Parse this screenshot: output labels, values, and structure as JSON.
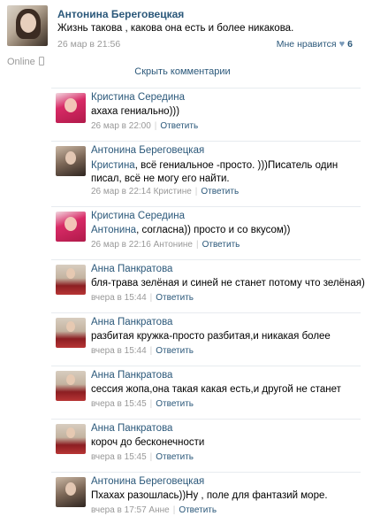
{
  "post": {
    "author": "Антонина Береговецкая",
    "text": "Жизнь такова , какова она есть и более никакова.",
    "date": "26 мар в 21:56",
    "online": "Online",
    "like_label": "Мне нравится",
    "like_count": "6",
    "hide_comments": "Скрыть комментарии"
  },
  "comments": [
    {
      "author": "Кристина Середина",
      "mention": "",
      "text": "ахаха гениально)))",
      "date": "26 мар в 22:00",
      "reply": "Ответить"
    },
    {
      "author": "Антонина Береговецкая",
      "mention": "Кристина",
      "text": ", всё гениальное -просто. )))Писатель один писал, всё не могу его найти.",
      "date": "26 мар в 22:14 Кристине",
      "reply": "Ответить"
    },
    {
      "author": "Кристина Середина",
      "mention": "Антонина",
      "text": ", согласна)) просто и со вкусом))",
      "date": "26 мар в 22:16 Антонине",
      "reply": "Ответить"
    },
    {
      "author": "Анна Панкратова",
      "mention": "",
      "text": "бля-трава зелёная и синей не станет потому что зелёная)",
      "date": "вчера в 15:44",
      "reply": "Ответить"
    },
    {
      "author": "Анна Панкратова",
      "mention": "",
      "text": "разбитая кружка-просто разбитая,и никакая более",
      "date": "вчера в 15:44",
      "reply": "Ответить"
    },
    {
      "author": "Анна Панкратова",
      "mention": "",
      "text": "сессия жопа,она такая какая есть,и другой не станет",
      "date": "вчера в 15:45",
      "reply": "Ответить"
    },
    {
      "author": "Анна Панкратова",
      "mention": "",
      "text": "короч до бесконечности",
      "date": "вчера в 15:45",
      "reply": "Ответить"
    },
    {
      "author": "Антонина Береговецкая",
      "mention": "",
      "text": "Пхахах разошлась))Ну , поле для фантазий море.",
      "date": "вчера в 17:57 Анне",
      "reply": "Ответить"
    }
  ]
}
